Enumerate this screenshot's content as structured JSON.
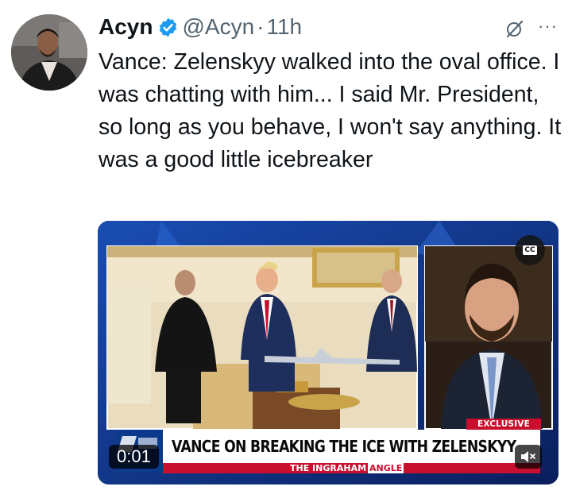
{
  "tweet": {
    "author_name": "Acyn",
    "handle": "@Acyn",
    "separator": "·",
    "time": "11h",
    "more": "···",
    "text": "Vance: Zelenskyy walked into the oval office. I was chatting with him... I said Mr. President, so long as you behave, I won't say anything. It was a good little icebreaker"
  },
  "video": {
    "cc_label": "CC",
    "exclusive_label": "EXCLUSIVE",
    "headline": "VANCE ON BREAKING THE ICE WITH ZELENSKYY",
    "show_name_prefix": "THE INGRAHAM",
    "show_name_highlight": "ANGLE",
    "timestamp": "0:01"
  },
  "colors": {
    "verified": "#1d9bf0",
    "fox_red": "#c8102e",
    "fox_blue": "#0b3a8c"
  },
  "icons": [
    "verified-badge-icon",
    "grok-icon",
    "more-icon",
    "cc-icon",
    "mute-icon"
  ]
}
